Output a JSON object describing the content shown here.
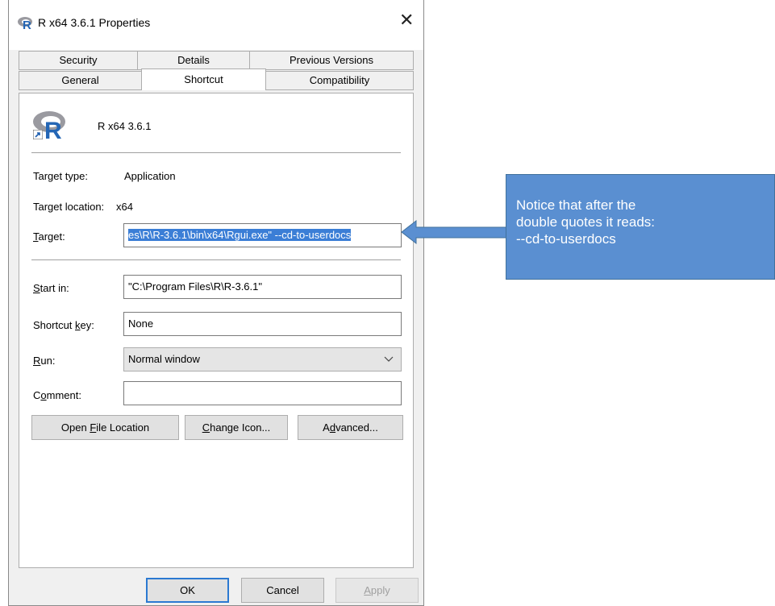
{
  "window": {
    "title": "R x64 3.6.1 Properties",
    "close_glyph": "✕"
  },
  "tabs": {
    "row1": [
      "Security",
      "Details",
      "Previous Versions"
    ],
    "row2": [
      "General",
      "Shortcut",
      "Compatibility"
    ],
    "active": "Shortcut"
  },
  "header": {
    "app_name": "R x64 3.6.1"
  },
  "fields": {
    "target_type_label": "Target type:",
    "target_type_value": "Application",
    "target_location_label": "Target location:",
    "target_location_value": "x64",
    "target_label_accel": "T",
    "target_label_rest": "arget:",
    "target_value": "es\\R\\R-3.6.1\\bin\\x64\\Rgui.exe\" --cd-to-userdocs",
    "start_in_label_accel": "S",
    "start_in_label_rest": "tart in:",
    "start_in_value": "\"C:\\Program Files\\R\\R-3.6.1\"",
    "shortcut_key_label_pre": "Shortcut ",
    "shortcut_key_label_accel": "k",
    "shortcut_key_label_rest": "ey:",
    "shortcut_key_value": "None",
    "run_label_accel": "R",
    "run_label_rest": "un:",
    "run_value": "Normal window",
    "comment_label_pre": "C",
    "comment_label_accel": "o",
    "comment_label_rest": "mment:",
    "comment_value": ""
  },
  "buttons": {
    "open_file_location_pre": "Open ",
    "open_file_location_accel": "F",
    "open_file_location_rest": "ile Location",
    "change_icon_accel": "C",
    "change_icon_rest": "hange Icon...",
    "advanced_pre": "A",
    "advanced_accel": "d",
    "advanced_rest": "vanced...",
    "ok": "OK",
    "cancel": "Cancel",
    "apply_accel": "A",
    "apply_rest": "pply"
  },
  "callout": {
    "line1": "Notice that after the",
    "line2": "double quotes it reads:",
    "line3": "--cd-to-userdocs"
  },
  "colors": {
    "selection": "#3b7ed6",
    "callout_fill": "#5a8fd1",
    "r_logo_blue": "#2466b5",
    "r_logo_gray": "#9a9aa0"
  },
  "icons": {
    "title": "r-logo-icon",
    "header": "r-logo-icon",
    "run_dropdown": "chevron-down-icon",
    "shortcut_overlay": "shortcut-arrow-icon"
  }
}
